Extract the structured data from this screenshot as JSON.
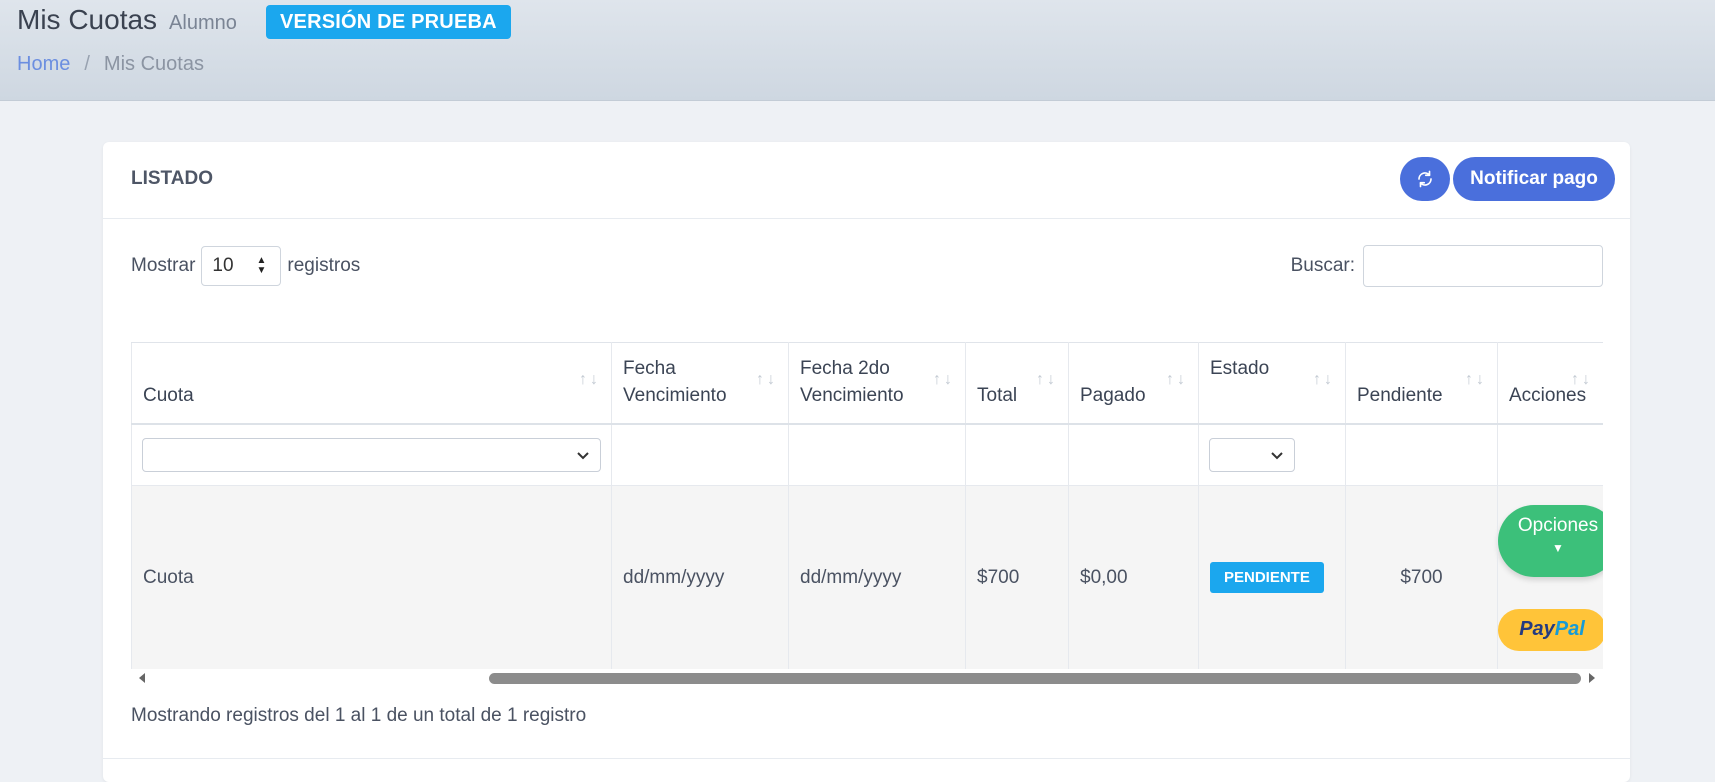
{
  "header": {
    "title": "Mis Cuotas",
    "subtitle": "Alumno",
    "trial_badge": "VERSIÓN DE PRUEBA",
    "breadcrumb": {
      "home": "Home",
      "separator": "/",
      "current": "Mis Cuotas"
    }
  },
  "card": {
    "title": "LISTADO",
    "refresh_icon": "refresh-icon",
    "notify_button": "Notificar pago"
  },
  "controls": {
    "show_label": "Mostrar",
    "page_length": "10",
    "records_label": "registros",
    "search_label": "Buscar:",
    "search_value": ""
  },
  "table": {
    "columns": [
      {
        "l1": "",
        "l2": "Cuota"
      },
      {
        "l1": "Fecha",
        "l2": "Vencimiento"
      },
      {
        "l1": "Fecha 2do",
        "l2": "Vencimiento"
      },
      {
        "l1": "",
        "l2": "Total"
      },
      {
        "l1": "",
        "l2": "Pagado"
      },
      {
        "l1": "Estado",
        "l2": ""
      },
      {
        "l1": "",
        "l2": "Pendiente"
      },
      {
        "l1": "",
        "l2": "Acciones"
      }
    ],
    "sort_icon": "↑↓",
    "rows": [
      {
        "cuota": "Cuota",
        "vencimiento": "dd/mm/yyyy",
        "vencimiento2": "dd/mm/yyyy",
        "total": "$700",
        "pagado": "$0,00",
        "estado": "PENDIENTE",
        "pendiente": "$700",
        "opciones": "Opciones",
        "paypal_1": "Pay",
        "paypal_2": "Pal"
      }
    ]
  },
  "footer": {
    "info": "Mostrando registros del 1 al 1 de un total de 1 registro"
  },
  "colors": {
    "primary": "#4a6fdc",
    "info": "#1ba7ee",
    "success": "#3cc07a",
    "paypal": "#ffc439"
  }
}
